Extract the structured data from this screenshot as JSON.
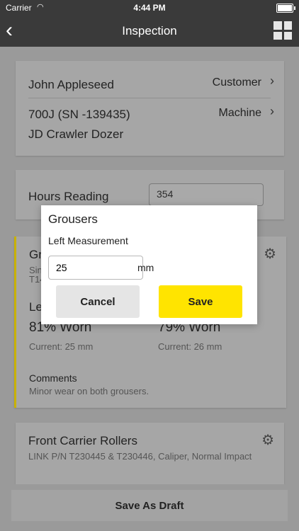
{
  "status_bar": {
    "carrier": "Carrier",
    "time": "4:44 PM"
  },
  "nav": {
    "title": "Inspection"
  },
  "customer_card": {
    "name": "John Appleseed",
    "customer_label": "Customer",
    "machine_model": "700J (SN -139435)",
    "machine_type": "JD Crawler Dozer",
    "machine_label": "Machine"
  },
  "hours": {
    "label": "Hours Reading",
    "value": "354"
  },
  "grousers_card": {
    "title": "Gr",
    "subtitle_line1": "Sin",
    "subtitle_line2": "T14",
    "left_label": "Le",
    "left_worn": "81% Worn",
    "right_worn": "79% Worn",
    "left_current": "Current: 25 mm",
    "right_current": "Current: 26 mm",
    "comments_label": "Comments",
    "comments_text": "Minor wear on both grousers."
  },
  "carrier_card": {
    "title": "Front Carrier Rollers",
    "subtitle": "LINK P/N T230445 & T230446, Caliper, Normal Impact"
  },
  "dialog": {
    "title": "Grousers",
    "field_label": "Left Measurement",
    "field_value": "25",
    "unit": "mm",
    "cancel_label": "Cancel",
    "save_label": "Save"
  },
  "footer": {
    "save_draft_label": "Save As Draft"
  },
  "colors": {
    "accent": "#FFE400",
    "nav_bg": "#3A3A3A",
    "overlay_bg": "#9A9A9A"
  }
}
